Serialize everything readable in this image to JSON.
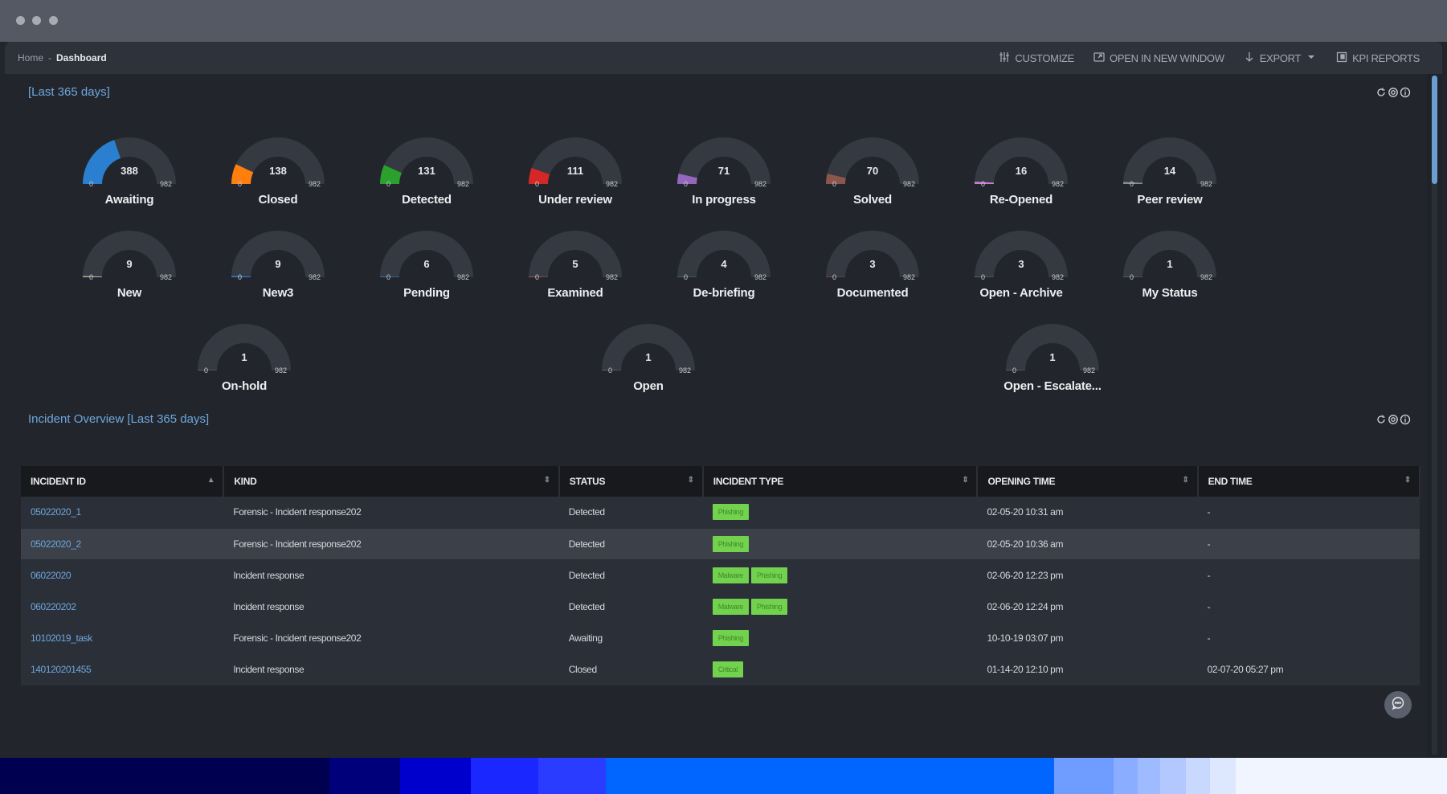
{
  "window": {
    "controls": [
      "close",
      "minimize",
      "maximize"
    ]
  },
  "breadcrumb": {
    "home": "Home",
    "separator": "-",
    "current": "Dashboard"
  },
  "toolbar": {
    "customize": "CUSTOMIZE",
    "open_new_window": "OPEN IN NEW WINDOW",
    "export": "EXPORT",
    "kpi_reports": "KPI REPORTS"
  },
  "gauges_widget": {
    "title": "[Last 365 days]",
    "min": "0",
    "max": "982",
    "max_value": 982,
    "items": [
      {
        "label": "Awaiting",
        "value": 388,
        "color": "#2a7fd0"
      },
      {
        "label": "Closed",
        "value": 138,
        "color": "#ff7f0e"
      },
      {
        "label": "Detected",
        "value": 131,
        "color": "#2ca02c"
      },
      {
        "label": "Under review",
        "value": 111,
        "color": "#d62728"
      },
      {
        "label": "In progress",
        "value": 71,
        "color": "#9467bd"
      },
      {
        "label": "Solved",
        "value": 70,
        "color": "#8c564b"
      },
      {
        "label": "Re-Opened",
        "value": 16,
        "color": "#c77dd1"
      },
      {
        "label": "Peer review",
        "value": 14,
        "color": "#8a8f96"
      },
      {
        "label": "New",
        "value": 9,
        "color": "#b8a890"
      },
      {
        "label": "New3",
        "value": 9,
        "color": "#2a7fd0"
      },
      {
        "label": "Pending",
        "value": 6,
        "color": "#3a6fa8"
      },
      {
        "label": "Examined",
        "value": 5,
        "color": "#c0504a"
      },
      {
        "label": "De-briefing",
        "value": 4,
        "color": "#3e8a4a"
      },
      {
        "label": "Documented",
        "value": 3,
        "color": "#a04444"
      },
      {
        "label": "Open - Archive",
        "value": 3,
        "color": "#6b6f76"
      },
      {
        "label": "My Status",
        "value": 1,
        "color": "#6b6f76"
      },
      {
        "label": "On-hold",
        "value": 1,
        "color": "#6b6f76"
      },
      {
        "label": "Open",
        "value": 1,
        "color": "#6b6f76"
      },
      {
        "label": "Open - Escalate...",
        "value": 1,
        "color": "#6b6f76"
      }
    ]
  },
  "incident_table": {
    "title": "Incident Overview [Last 365 days]",
    "columns": [
      "INCIDENT ID",
      "KIND",
      "STATUS",
      "INCIDENT TYPE",
      "OPENING TIME",
      "END TIME"
    ],
    "rows": [
      {
        "id": "05022020_1",
        "kind": "Forensic - Incident response202",
        "status": "Detected",
        "types": [
          "Phishing"
        ],
        "opening": "02-05-20 10:31 am",
        "end": "-"
      },
      {
        "id": "05022020_2",
        "kind": "Forensic - Incident response202",
        "status": "Detected",
        "types": [
          "Phishing"
        ],
        "opening": "02-05-20 10:36 am",
        "end": "-"
      },
      {
        "id": "06022020",
        "kind": "Incident response",
        "status": "Detected",
        "types": [
          "Malware",
          "Phishing"
        ],
        "opening": "02-06-20 12:23 pm",
        "end": "-"
      },
      {
        "id": "060220202",
        "kind": "Incident response",
        "status": "Detected",
        "types": [
          "Malware",
          "Phishing"
        ],
        "opening": "02-06-20 12:24 pm",
        "end": "-"
      },
      {
        "id": "10102019_task",
        "kind": "Forensic - Incident response202",
        "status": "Awaiting",
        "types": [
          "Phishing"
        ],
        "opening": "10-10-19 03:07 pm",
        "end": "-"
      },
      {
        "id": "140120201455",
        "kind": "Incident response",
        "status": "Closed",
        "types": [
          "Critical"
        ],
        "opening": "01-14-20 12:10 pm",
        "end": "02-07-20 05:27 pm"
      }
    ]
  },
  "colors": {
    "accent": "#6fa6dd",
    "tag_bg": "#72d24e",
    "gauge_track": "#343942"
  },
  "bottom_stripe": [
    "#000050",
    "#00007a",
    "#0000cc",
    "#1a28ff",
    "#2a3cff",
    "#0066ff",
    "#6f9cff",
    "#8aadff",
    "#9ebbff",
    "#b2c8ff",
    "#c8d8ff",
    "#dde8ff",
    "#f0f5ff"
  ]
}
